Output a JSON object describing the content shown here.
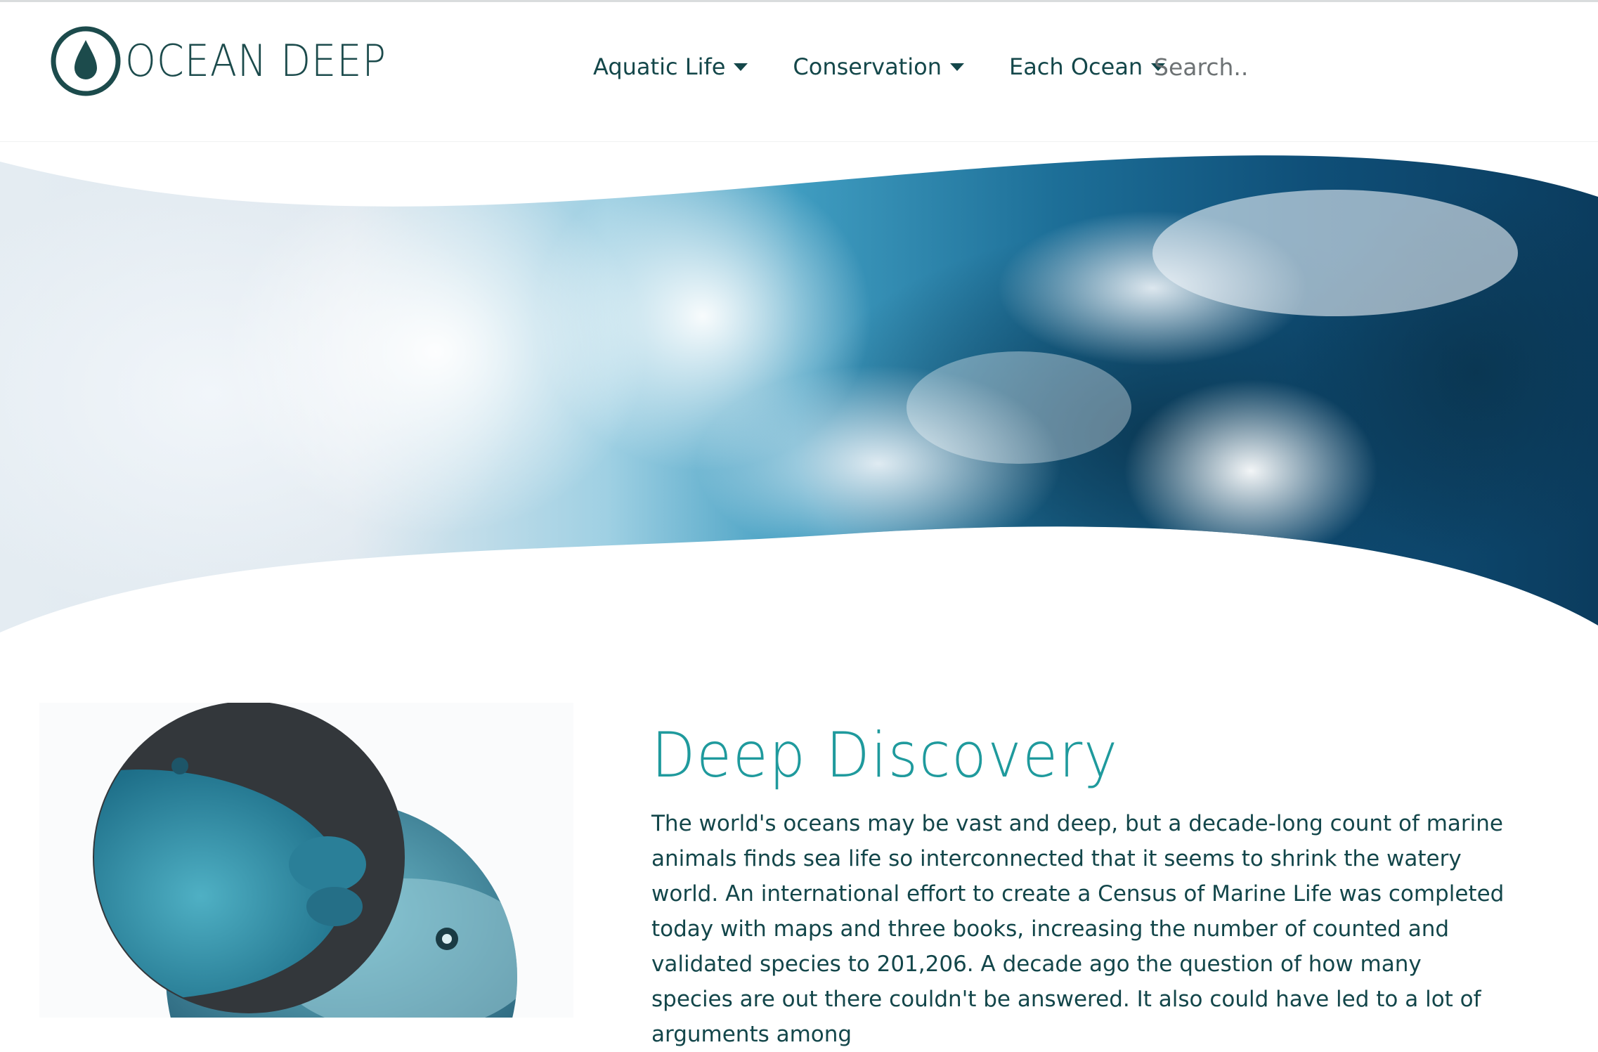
{
  "brand": {
    "name": "OCEAN DEEP"
  },
  "nav": {
    "items": [
      {
        "label": "Aquatic Life"
      },
      {
        "label": "Conservation"
      },
      {
        "label": "Each Ocean"
      }
    ]
  },
  "search": {
    "placeholder": "Search.."
  },
  "intro": {
    "title": "Deep Discovery",
    "body": "The world's oceans may be vast and deep, but a decade-long count of marine animals finds sea life so interconnected that it seems to shrink the watery world. An international effort to create a Census of Marine Life was completed today with maps and three books, increasing the number of counted and validated species to 201,206. A decade ago the question of how many species are out there couldn't be answered. It also could have led to a lot of arguments among"
  },
  "colors": {
    "brand_dark": "#1c4b4c",
    "accent_teal": "#1f9a9d",
    "nav_text": "#14474a"
  }
}
